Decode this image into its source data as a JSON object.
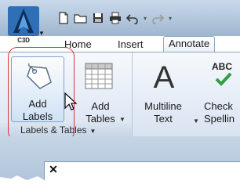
{
  "app_button": {
    "label": "C3D"
  },
  "tabs": [
    {
      "label": "Home"
    },
    {
      "label": "Insert"
    },
    {
      "label": "Annotate"
    }
  ],
  "panel": {
    "title": "Labels & Tables",
    "buttons": {
      "add_labels": {
        "line1": "Add",
        "line2": "Labels"
      },
      "add_tables": {
        "line1": "Add",
        "line2": "Tables"
      },
      "multiline_text": {
        "line1": "Multiline",
        "line2": "Text"
      },
      "check_spelling": {
        "line1": "Check",
        "line2": "Spellin"
      }
    }
  },
  "check_spelling_icon_text": "ABC",
  "colors": {
    "accent": "#2b6cb0",
    "highlight_outline": "#d63a3a",
    "ribbon_bg": "#e4ecf6"
  }
}
